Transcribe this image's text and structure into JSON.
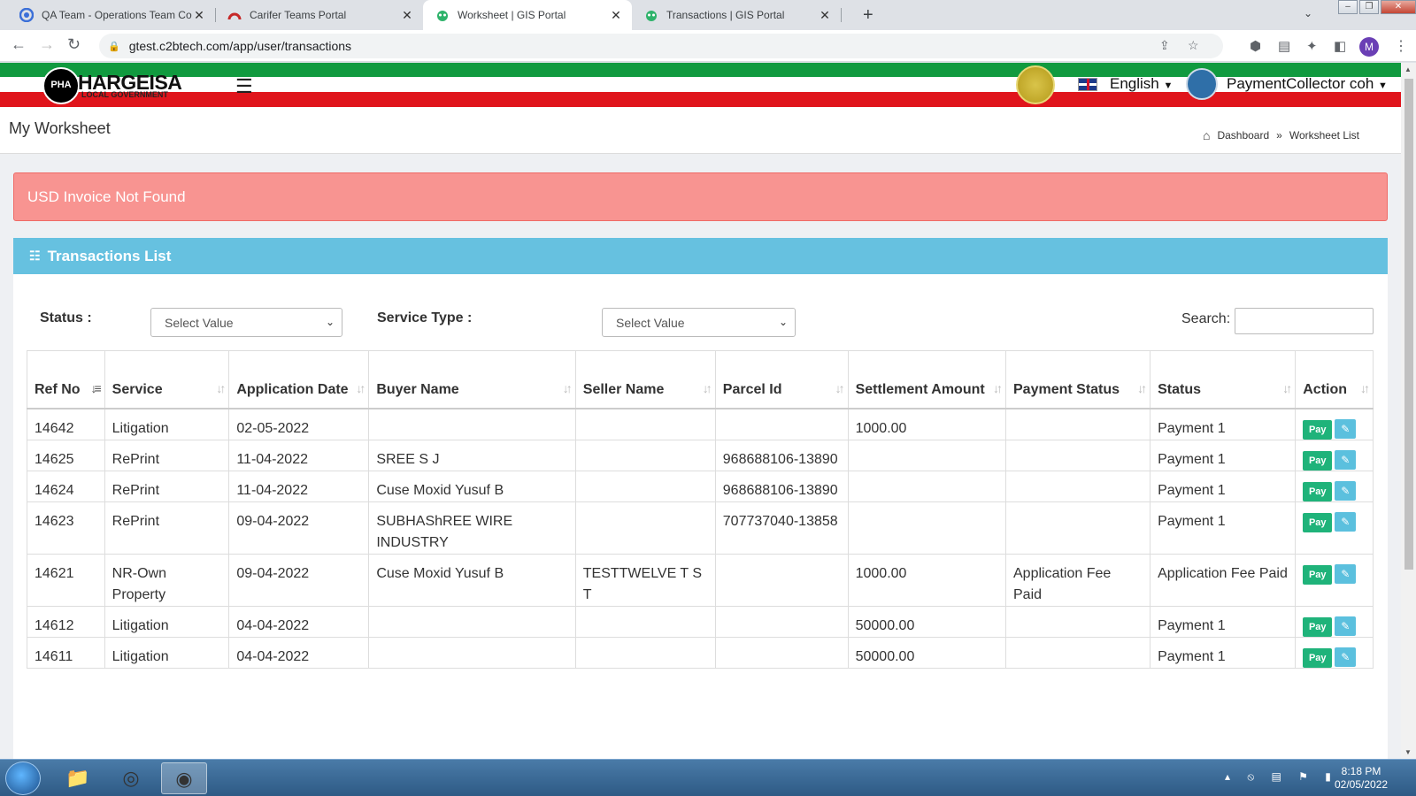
{
  "browser": {
    "tabs": [
      {
        "title": "QA Team - Operations Team Coll",
        "favicon": "teams-icon",
        "active": false
      },
      {
        "title": "Carifer Teams Portal",
        "favicon": "carifer-icon",
        "active": false
      },
      {
        "title": "Worksheet | GIS Portal",
        "favicon": "gis-icon",
        "active": true
      },
      {
        "title": "Transactions | GIS Portal",
        "favicon": "gis-icon",
        "active": false
      }
    ],
    "url": "gtest.c2btech.com/app/user/transactions",
    "profile_initial": "M"
  },
  "header": {
    "logo_text": "HARGEISA",
    "logo_subtext": "LOCAL GOVERNMENT",
    "logo_emblem": "PHA",
    "language": "English",
    "user": "PaymentCollector coh"
  },
  "page": {
    "title": "My Worksheet",
    "breadcrumb": [
      "Dashboard",
      "Worksheet List"
    ]
  },
  "alert": {
    "message": "USD Invoice Not Found"
  },
  "panel": {
    "title": "Transactions List",
    "filters": {
      "status_label": "Status :",
      "status_value": "Select Value",
      "service_type_label": "Service Type :",
      "service_type_value": "Select Value",
      "search_label": "Search:"
    }
  },
  "table": {
    "columns": [
      "Ref No",
      "Service",
      "Application Date",
      "Buyer Name",
      "Seller Name",
      "Parcel Id",
      "Settlement Amount",
      "Payment Status",
      "Status",
      "Action"
    ],
    "rows": [
      {
        "ref": "14642",
        "service": "Litigation",
        "date": "02-05-2022",
        "buyer": "",
        "seller": "",
        "parcel": "",
        "amount": "1000.00",
        "payment_status": "",
        "status": "Payment 1"
      },
      {
        "ref": "14625",
        "service": "RePrint",
        "date": "11-04-2022",
        "buyer": "SREE S J",
        "seller": "",
        "parcel": "968688106-13890",
        "amount": "",
        "payment_status": "",
        "status": "Payment 1"
      },
      {
        "ref": "14624",
        "service": "RePrint",
        "date": "11-04-2022",
        "buyer": "Cuse Moxid Yusuf B",
        "seller": "",
        "parcel": "968688106-13890",
        "amount": "",
        "payment_status": "",
        "status": "Payment 1"
      },
      {
        "ref": "14623",
        "service": "RePrint",
        "date": "09-04-2022",
        "buyer": "SUBHAShREE WIRE INDUSTRY",
        "seller": "",
        "parcel": "707737040-13858",
        "amount": "",
        "payment_status": "",
        "status": "Payment 1"
      },
      {
        "ref": "14621",
        "service": "NR-Own Property",
        "date": "09-04-2022",
        "buyer": "Cuse Moxid Yusuf B",
        "seller": "TESTTWELVE T S T",
        "parcel": "",
        "amount": "1000.00",
        "payment_status": "Application Fee Paid",
        "status": "Application Fee Paid"
      },
      {
        "ref": "14612",
        "service": "Litigation",
        "date": "04-04-2022",
        "buyer": "",
        "seller": "",
        "parcel": "",
        "amount": "50000.00",
        "payment_status": "",
        "status": "Payment 1"
      },
      {
        "ref": "14611",
        "service": "Litigation",
        "date": "04-04-2022",
        "buyer": "",
        "seller": "",
        "parcel": "",
        "amount": "50000.00",
        "payment_status": "",
        "status": "Payment 1"
      }
    ],
    "pay_label": "Pay"
  },
  "taskbar": {
    "time": "8:18 PM",
    "date": "02/05/2022"
  },
  "colors": {
    "panel_header": "#66c1e0",
    "alert_bg": "#f89491",
    "pay_button": "#1fb37a",
    "edit_button": "#5bc0de",
    "header_green": "#119a3f",
    "header_red": "#e0151c"
  }
}
